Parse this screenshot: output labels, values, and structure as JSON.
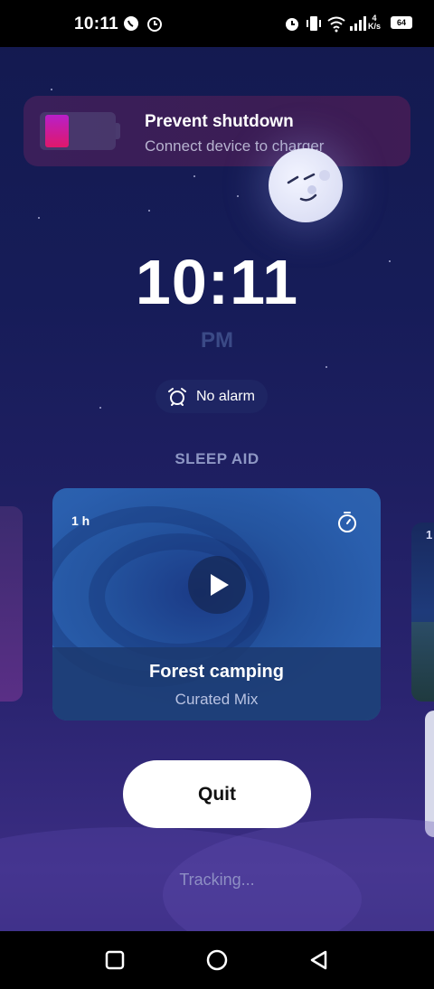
{
  "status_bar": {
    "time": "10:11",
    "network_speed_value": "4",
    "network_speed_unit": "K/s",
    "battery_level": "64"
  },
  "banner": {
    "title": "Prevent shutdown",
    "subtitle": "Connect device to charger"
  },
  "clock": {
    "time": "10:11",
    "period": "PM"
  },
  "alarm": {
    "label": "No alarm"
  },
  "sleep_aid": {
    "section_title": "SLEEP AID",
    "card": {
      "duration": "1 h",
      "title": "Forest camping",
      "subtitle": "Curated Mix"
    },
    "next_card_peek": "1"
  },
  "quit_label": "Quit",
  "tracking_label": "Tracking...",
  "colors": {
    "background_top": "#131a4f",
    "background_bottom": "#3b2d83",
    "banner": "#3a1f5a",
    "battery_accent": "#e0186b",
    "card": "#2a5fae",
    "ampm": "#3b4a86"
  },
  "icons": {
    "status": [
      "whatsapp-icon",
      "alarm-icon",
      "alarm-icon",
      "vibrate-icon",
      "wifi-icon",
      "signal-icon",
      "battery-icon"
    ],
    "nav": [
      "square-recents-icon",
      "circle-home-icon",
      "triangle-back-icon"
    ]
  }
}
